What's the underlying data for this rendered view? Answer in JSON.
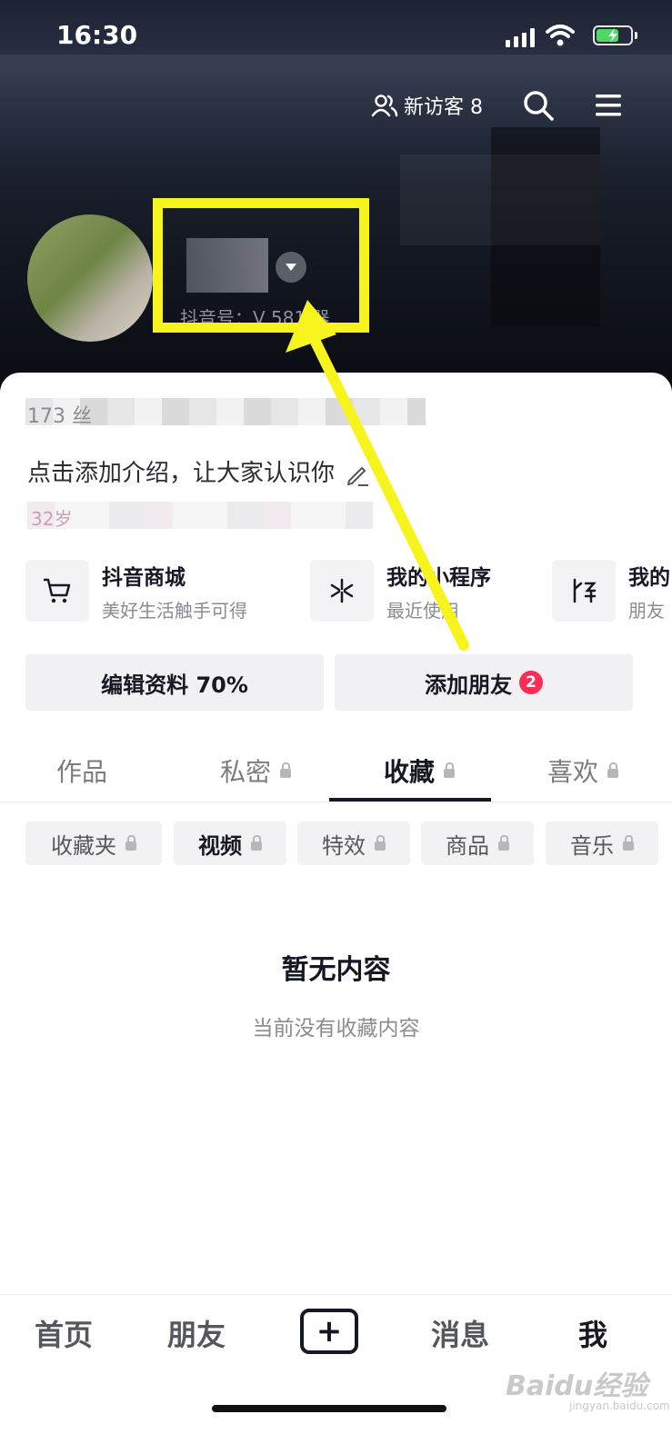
{
  "status_bar": {
    "time": "16:30"
  },
  "header": {
    "visitors_label": "新访客 8",
    "douyin_id": "抖音号：V 581 器"
  },
  "profile": {
    "stats_text": "173 丝",
    "bio": "点击添加介绍，让大家认识你",
    "tags_text": "32岁"
  },
  "services": [
    {
      "title": "抖音商城",
      "subtitle": "美好生活触手可得",
      "icon": "cart-icon"
    },
    {
      "title": "我的小程序",
      "subtitle": "最近使用",
      "icon": "mini-program-icon"
    },
    {
      "title": "我的",
      "subtitle": "朋友",
      "icon": "group-icon"
    }
  ],
  "actions": {
    "edit_profile": "编辑资料 70%",
    "add_friends": "添加朋友",
    "add_friends_badge": "2"
  },
  "tabs": [
    {
      "label": "作品",
      "locked": false
    },
    {
      "label": "私密",
      "locked": true
    },
    {
      "label": "收藏",
      "locked": true,
      "active": true
    },
    {
      "label": "喜欢",
      "locked": true
    }
  ],
  "chips": [
    {
      "label": "收藏夹"
    },
    {
      "label": "视频",
      "active": true
    },
    {
      "label": "特效"
    },
    {
      "label": "商品"
    },
    {
      "label": "音乐"
    }
  ],
  "empty_state": {
    "title": "暂无内容",
    "subtitle": "当前没有收藏内容"
  },
  "bottom_nav": {
    "home": "首页",
    "friends": "朋友",
    "plus": "+",
    "messages": "消息",
    "me": "我"
  },
  "watermark": {
    "logo": "Baidu经验",
    "sub": "jingyan.baidu.com"
  },
  "colors": {
    "highlight": "#f7f31c",
    "badge": "#fe2c55",
    "battery": "#4cd964"
  }
}
